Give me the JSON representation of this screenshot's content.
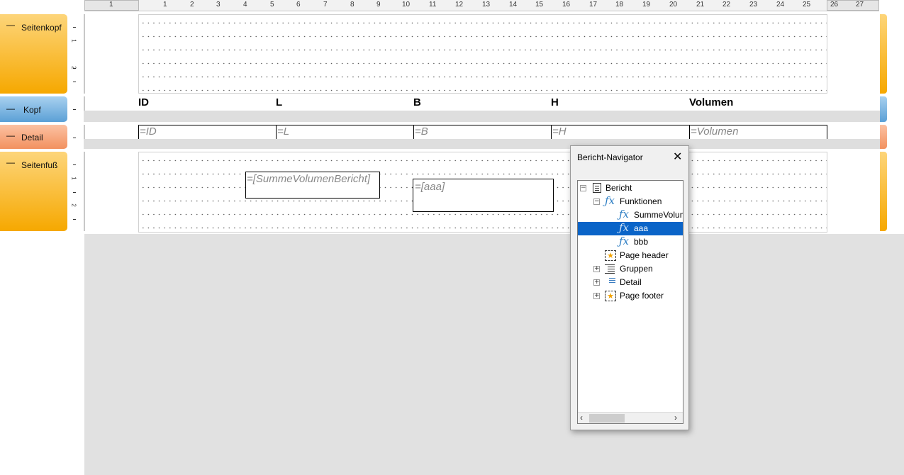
{
  "ruler": {
    "numbers": [
      "1",
      "1",
      "2",
      "3",
      "4",
      "5",
      "6",
      "7",
      "8",
      "9",
      "10",
      "11",
      "12",
      "13",
      "14",
      "15",
      "16",
      "17",
      "18",
      "19",
      "20",
      "21",
      "22",
      "23",
      "24",
      "25",
      "26",
      "27"
    ]
  },
  "sections": {
    "page_header": {
      "label": "Seitenkopf",
      "color": "#f6a800"
    },
    "header": {
      "label": "Kopf",
      "color": "#5ba0d6"
    },
    "detail": {
      "label": "Detail",
      "color": "#f2915f"
    },
    "page_footer": {
      "label": "Seitenfuß",
      "color": "#f6a800"
    },
    "collapse_symbol": "—"
  },
  "vertical_ruler": {
    "labels": [
      "1",
      "2",
      "1",
      "2"
    ]
  },
  "header_row": {
    "columns": [
      "ID",
      "L",
      "B",
      "H",
      "Volumen"
    ]
  },
  "detail_row": {
    "fields": [
      "=ID",
      "=L",
      "=B",
      "=H",
      "=Volumen"
    ]
  },
  "footer_fields": {
    "sum": "=[SummeVolumenBericht]",
    "aaa": "=[aaa]"
  },
  "navigator": {
    "title": "Bericht-Navigator",
    "close": "✕",
    "tree": [
      {
        "label": "Bericht",
        "icon": "report-icon"
      },
      {
        "label": "Funktionen",
        "icon": "function-icon"
      },
      {
        "label": "SummeVolumenBericht",
        "icon": "function-icon"
      },
      {
        "label": "aaa",
        "icon": "function-icon",
        "selected": true
      },
      {
        "label": "bbb",
        "icon": "function-icon"
      },
      {
        "label": "Page header",
        "icon": "page-header-icon"
      },
      {
        "label": "Gruppen",
        "icon": "groups-icon"
      },
      {
        "label": "Detail",
        "icon": "detail-icon"
      },
      {
        "label": "Page footer",
        "icon": "page-footer-icon"
      }
    ]
  },
  "colors": {
    "selection": "#0a64c8",
    "function_icon": "#2f7fc4"
  }
}
